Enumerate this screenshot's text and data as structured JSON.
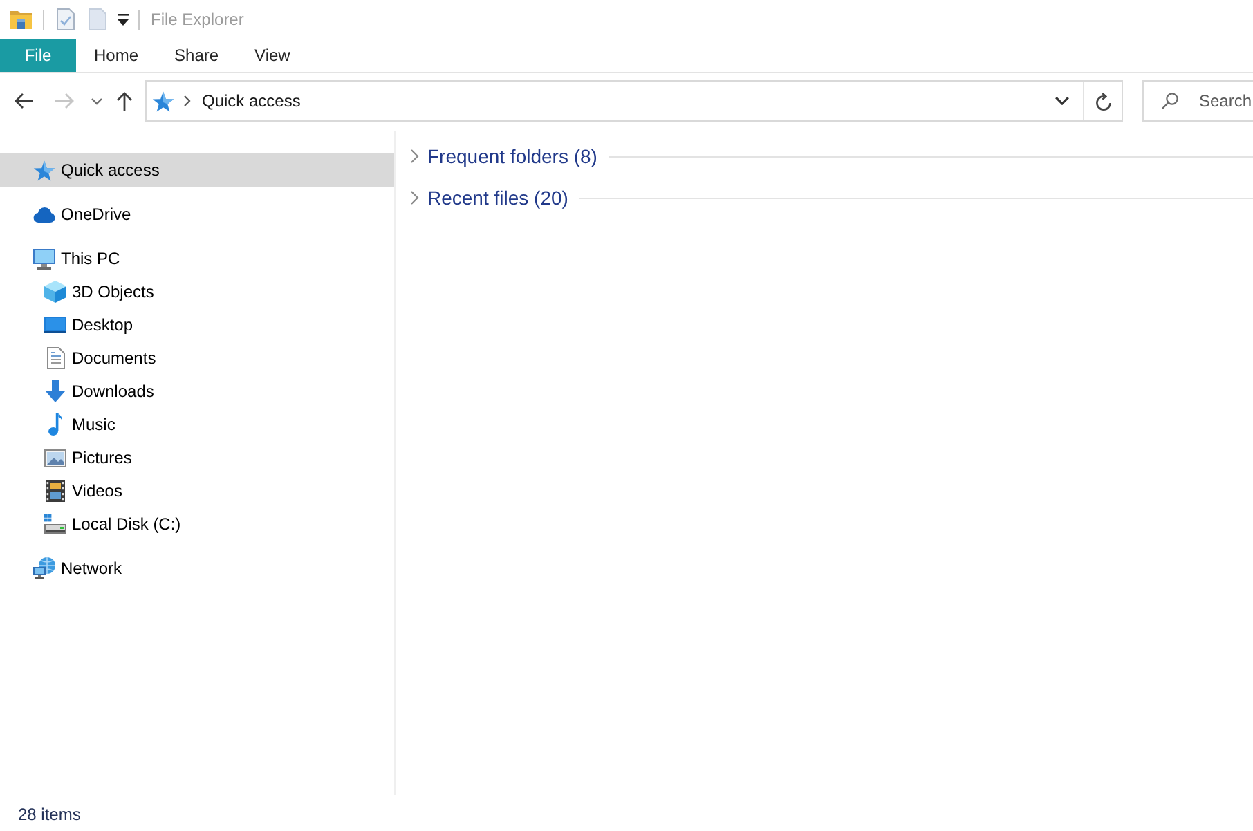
{
  "window": {
    "title": "File Explorer"
  },
  "ribbon_tabs": [
    {
      "label": "File",
      "kind": "menu"
    },
    {
      "label": "Home",
      "kind": "tab"
    },
    {
      "label": "Share",
      "kind": "tab"
    },
    {
      "label": "View",
      "kind": "tab"
    }
  ],
  "nav_buttons": [
    {
      "kind": "back",
      "disabled": false
    },
    {
      "kind": "forward",
      "disabled": true
    },
    {
      "kind": "recent",
      "disabled": false
    },
    {
      "kind": "up",
      "disabled": false
    }
  ],
  "address_bar": {
    "path": [
      "Quick access"
    ]
  },
  "search": {
    "placeholder": "Search"
  },
  "sidebar": {
    "items": [
      {
        "label": "Quick access",
        "kind": "quick_access",
        "selected": true
      },
      {
        "label": "OneDrive",
        "kind": "cloud",
        "selected": false
      },
      {
        "label": "This PC",
        "kind": "computer",
        "selected": false,
        "children": [
          {
            "label": "3D Objects",
            "kind": "objects",
            "selected": false
          },
          {
            "label": "Desktop",
            "kind": "desktop",
            "selected": false
          },
          {
            "label": "Documents",
            "kind": "documents",
            "selected": false
          },
          {
            "label": "Downloads",
            "kind": "downloads",
            "selected": false
          },
          {
            "label": "Music",
            "kind": "music",
            "selected": false
          },
          {
            "label": "Pictures",
            "kind": "pictures",
            "selected": false
          },
          {
            "label": "Videos",
            "kind": "videos",
            "selected": false
          },
          {
            "label": "Local Disk (C:)",
            "kind": "drive",
            "selected": false
          }
        ]
      },
      {
        "label": "Network",
        "kind": "network",
        "selected": false
      }
    ]
  },
  "groups": [
    {
      "label": "Frequent folders (8)",
      "expanded": false
    },
    {
      "label": "Recent files (20)",
      "expanded": false
    }
  ],
  "status_bar": {
    "text": "28 items"
  }
}
